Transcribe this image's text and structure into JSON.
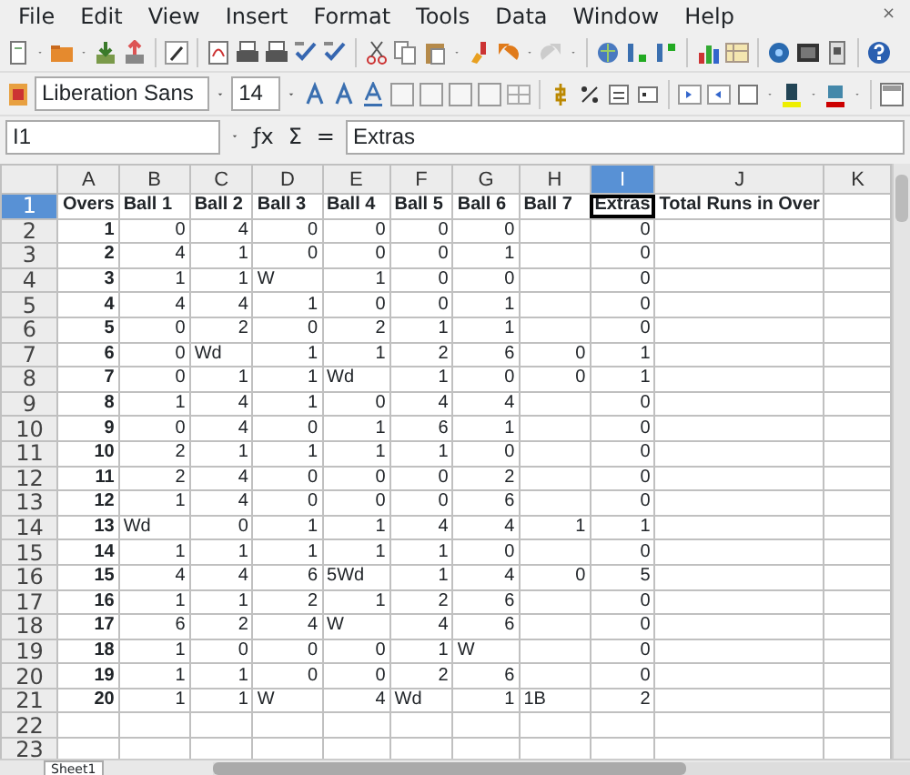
{
  "menu": [
    "File",
    "Edit",
    "View",
    "Insert",
    "Format",
    "Tools",
    "Data",
    "Window",
    "Help"
  ],
  "close": "×",
  "font_toolbar": {
    "font": "Liberation Sans",
    "size": "14"
  },
  "formula_bar": {
    "cell": "I1",
    "buttons": [
      "ƒx",
      "Σ",
      "="
    ],
    "content": "Extras"
  },
  "columns": [
    {
      "letter": "A",
      "selected": false,
      "bold": true
    },
    {
      "letter": "B",
      "selected": false
    },
    {
      "letter": "C",
      "selected": false
    },
    {
      "letter": "D",
      "selected": false
    },
    {
      "letter": "E",
      "selected": false
    },
    {
      "letter": "F",
      "selected": false
    },
    {
      "letter": "G",
      "selected": false
    },
    {
      "letter": "H",
      "selected": false
    },
    {
      "letter": "I",
      "selected": true
    },
    {
      "letter": "J",
      "selected": false
    },
    {
      "letter": "K",
      "selected": false
    }
  ],
  "rows": [
    {
      "number": "1",
      "selected": true,
      "kind": "header",
      "cells": [
        "Overs",
        "Ball 1",
        "Ball 2",
        "Ball 3",
        "Ball 4",
        "Ball 5",
        "Ball 6",
        "Ball 7",
        {
          "t": "Extras",
          "selected": true
        },
        "Total Runs in Over"
      ]
    },
    {
      "number": "2",
      "selected": false,
      "kind": "data",
      "cells": [
        "1",
        "0",
        "4",
        "0",
        "0",
        "0",
        "0",
        null,
        "0"
      ]
    },
    {
      "number": "3",
      "selected": false,
      "kind": "data",
      "cells": [
        "2",
        "4",
        "1",
        "0",
        "0",
        "0",
        "1",
        null,
        "0"
      ]
    },
    {
      "number": "4",
      "selected": false,
      "kind": "data",
      "cells": [
        "3",
        "1",
        "1",
        {
          "t": "W",
          "kind": "text"
        },
        "1",
        "0",
        "0",
        null,
        "0"
      ]
    },
    {
      "number": "5",
      "selected": false,
      "kind": "data",
      "cells": [
        "4",
        "4",
        "4",
        "1",
        "0",
        "0",
        "1",
        null,
        "0"
      ]
    },
    {
      "number": "6",
      "selected": false,
      "kind": "data",
      "cells": [
        "5",
        "0",
        "2",
        "0",
        "2",
        "1",
        "1",
        null,
        "0"
      ]
    },
    {
      "number": "7",
      "selected": false,
      "kind": "data",
      "cells": [
        "6",
        "0",
        {
          "t": "Wd",
          "kind": "text"
        },
        "1",
        "1",
        "2",
        "6",
        "0",
        "1"
      ]
    },
    {
      "number": "8",
      "selected": false,
      "kind": "data",
      "cells": [
        "7",
        "0",
        "1",
        "1",
        {
          "t": "Wd",
          "kind": "text"
        },
        "1",
        "0",
        "0",
        "1"
      ]
    },
    {
      "number": "9",
      "selected": false,
      "kind": "data",
      "cells": [
        "8",
        "1",
        "4",
        "1",
        "0",
        "4",
        "4",
        null,
        "0"
      ]
    },
    {
      "number": "10",
      "selected": false,
      "kind": "data",
      "cells": [
        "9",
        "0",
        "4",
        "0",
        "1",
        "6",
        "1",
        null,
        "0"
      ]
    },
    {
      "number": "11",
      "selected": false,
      "kind": "data",
      "cells": [
        "10",
        "2",
        "1",
        "1",
        "1",
        "1",
        "0",
        null,
        "0"
      ]
    },
    {
      "number": "12",
      "selected": false,
      "kind": "data",
      "cells": [
        "11",
        "2",
        "4",
        "0",
        "0",
        "0",
        "2",
        null,
        "0"
      ]
    },
    {
      "number": "13",
      "selected": false,
      "kind": "data",
      "cells": [
        "12",
        "1",
        "4",
        "0",
        "0",
        "0",
        "6",
        null,
        "0"
      ]
    },
    {
      "number": "14",
      "selected": false,
      "kind": "data",
      "cells": [
        "13",
        {
          "t": "Wd",
          "kind": "text"
        },
        "0",
        "1",
        "1",
        "4",
        "4",
        "1",
        "1"
      ]
    },
    {
      "number": "15",
      "selected": false,
      "kind": "data",
      "cells": [
        "14",
        "1",
        "1",
        "1",
        "1",
        "1",
        "0",
        null,
        "0"
      ]
    },
    {
      "number": "16",
      "selected": false,
      "kind": "data",
      "cells": [
        "15",
        "4",
        "4",
        "6",
        {
          "t": "5Wd",
          "kind": "text"
        },
        "1",
        "4",
        "0",
        "5"
      ]
    },
    {
      "number": "17",
      "selected": false,
      "kind": "data",
      "cells": [
        "16",
        "1",
        "1",
        "2",
        "1",
        "2",
        "6",
        null,
        "0"
      ]
    },
    {
      "number": "18",
      "selected": false,
      "kind": "data",
      "cells": [
        "17",
        "6",
        "2",
        "4",
        {
          "t": "W",
          "kind": "text"
        },
        "4",
        "6",
        null,
        "0"
      ]
    },
    {
      "number": "19",
      "selected": false,
      "kind": "data",
      "cells": [
        "18",
        "1",
        "0",
        "0",
        "0",
        "1",
        {
          "t": "W",
          "kind": "text"
        },
        null,
        "0"
      ]
    },
    {
      "number": "20",
      "selected": false,
      "kind": "data",
      "cells": [
        "19",
        "1",
        "1",
        "0",
        "0",
        "2",
        "6",
        null,
        "0"
      ]
    },
    {
      "number": "21",
      "selected": false,
      "kind": "data",
      "cells": [
        "20",
        "1",
        "1",
        {
          "t": "W",
          "kind": "text"
        },
        "4",
        {
          "t": "Wd",
          "kind": "text"
        },
        "1",
        {
          "t": "1B",
          "kind": "text"
        },
        "2"
      ]
    },
    {
      "number": "22",
      "selected": false,
      "kind": "data"
    },
    {
      "number": "23",
      "selected": false,
      "kind": "data"
    }
  ],
  "sheet_tabs": [
    {
      "label": "Sheet1",
      "selected": true
    }
  ]
}
